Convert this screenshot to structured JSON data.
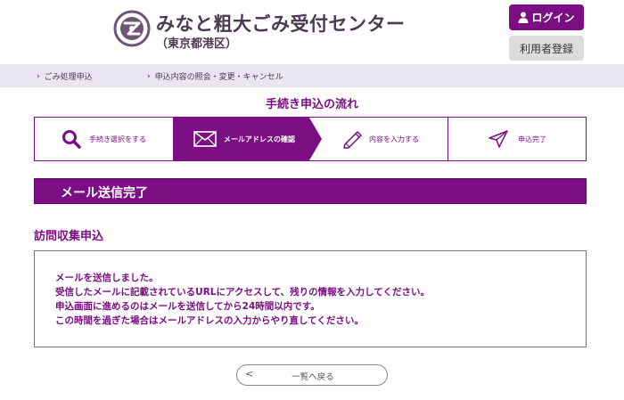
{
  "header": {
    "title": "みなと粗大ごみ受付センター",
    "subtitle": "（東京都港区）",
    "login_label": "ログイン",
    "register_label": "利用者登録"
  },
  "nav": {
    "items": [
      {
        "label": "ごみ処理申込"
      },
      {
        "label": "申込内容の照会・変更・キャンセル"
      }
    ]
  },
  "flow": {
    "title": "手続き申込の流れ",
    "steps": [
      {
        "label": "手続き選択をする",
        "icon": "search-icon",
        "active": false
      },
      {
        "label": "メールアドレスの確認",
        "icon": "envelope-icon",
        "active": true
      },
      {
        "label": "内容を入力する",
        "icon": "pencil-icon",
        "active": false
      },
      {
        "label": "申込完了",
        "icon": "paper-plane-icon",
        "active": false
      }
    ]
  },
  "section": {
    "title": "メール送信完了"
  },
  "subsection": {
    "title": "訪問収集申込"
  },
  "message": {
    "lines": [
      "メールを送信しました。",
      "受信したメールに記載されているURLにアクセスして、残りの情報を入力してください。",
      "申込画面に進めるのはメールを送信してから24時間以内です。",
      "この時間を過ぎた場合はメールアドレスの入力からやり直してください。"
    ]
  },
  "back_button": {
    "arrow": "<",
    "label": "一覧へ戻る"
  },
  "colors": {
    "accent": "#7b0e82",
    "nav_bg": "#e9e5f3",
    "register_bg": "#dcdcdc"
  }
}
